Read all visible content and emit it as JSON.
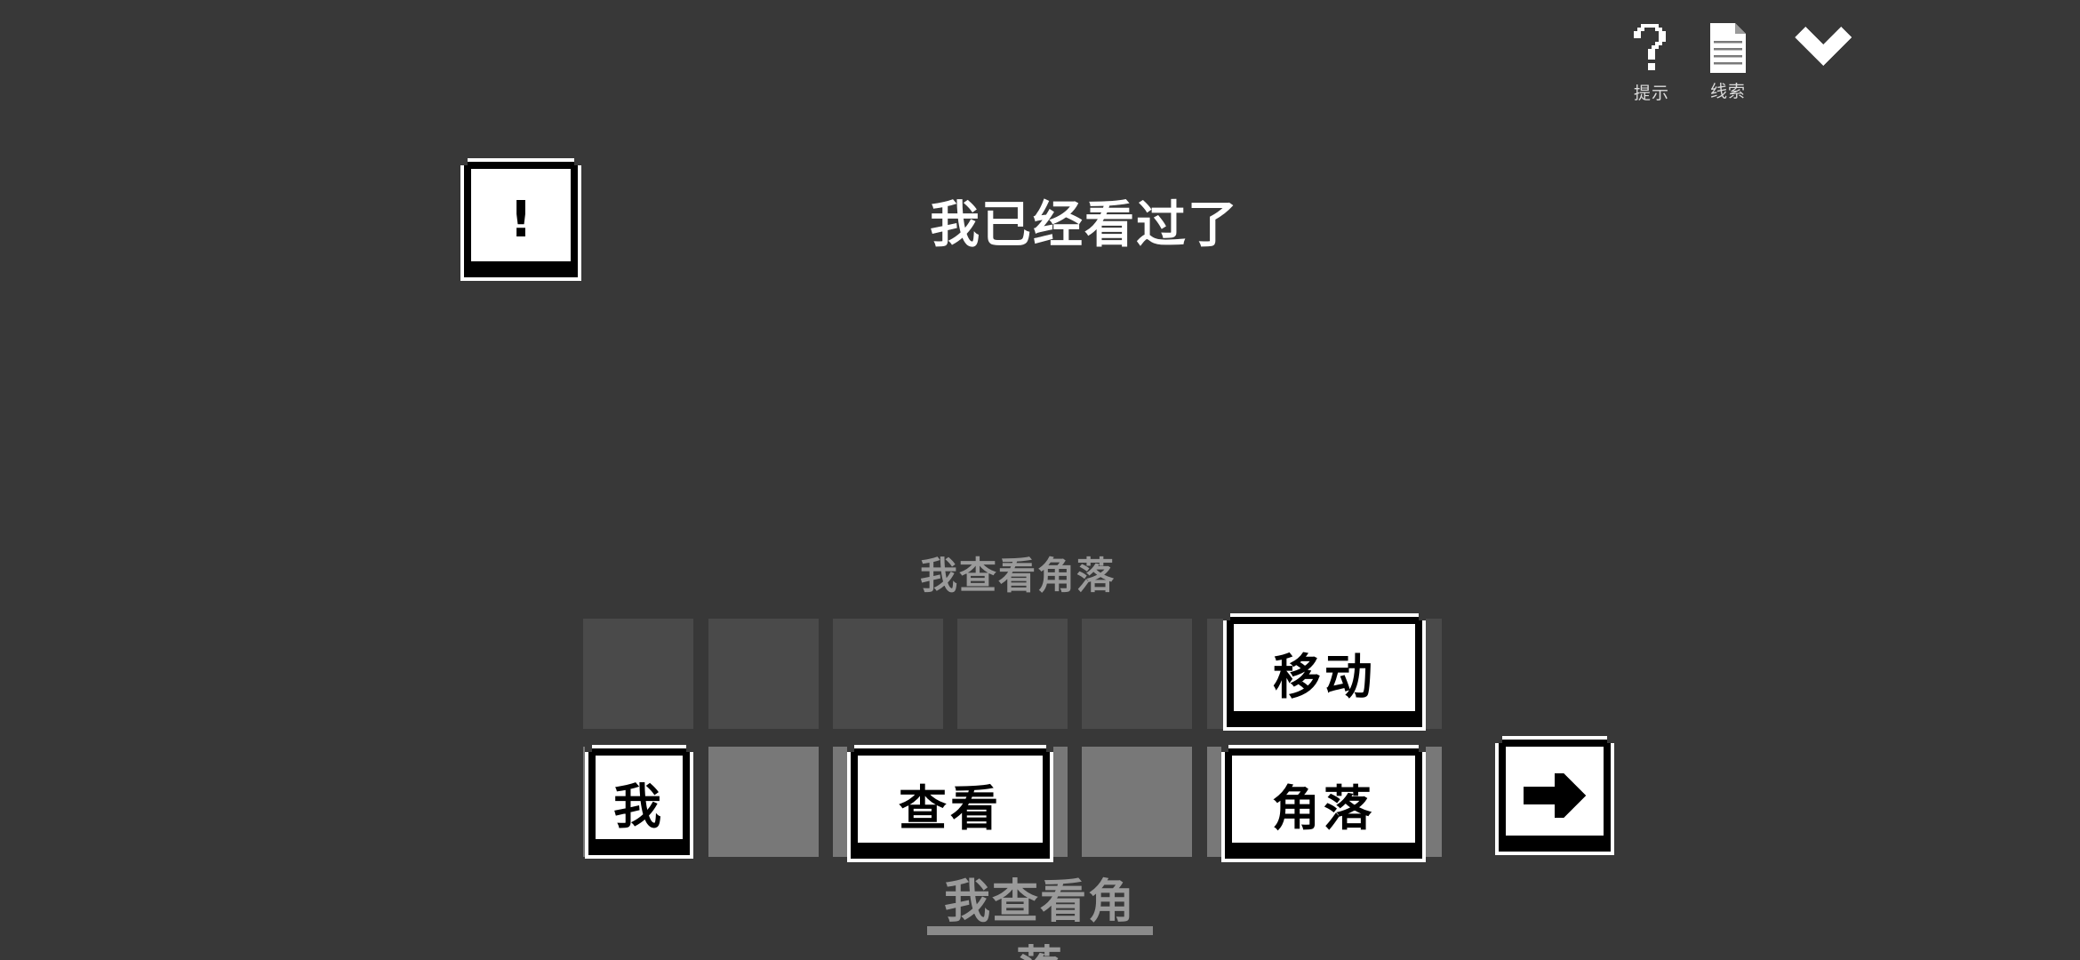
{
  "toolbar": {
    "hint_label": "提示",
    "clue_label": "线索",
    "hint_icon": "question-mark-icon",
    "clue_icon": "document-icon",
    "collapse_icon": "chevron-down-icon"
  },
  "dialog": {
    "alert_symbol": "!",
    "message": "我已经看过了"
  },
  "sentence_preview": "我查看角落",
  "word_bank": {
    "top_row": [
      "",
      "",
      "",
      "",
      "",
      "移动"
    ],
    "bottom_row": [
      "我",
      "",
      "查看",
      "",
      "角落"
    ]
  },
  "submit_icon": "arrow-right-icon",
  "answer": "我查看角落",
  "colors": {
    "background": "#383838",
    "tile": "#ffffff",
    "tile_border": "#000000",
    "empty_slot": "#4a4a4a",
    "filled_slot": "#787878",
    "muted_text": "#9a9a9a"
  }
}
